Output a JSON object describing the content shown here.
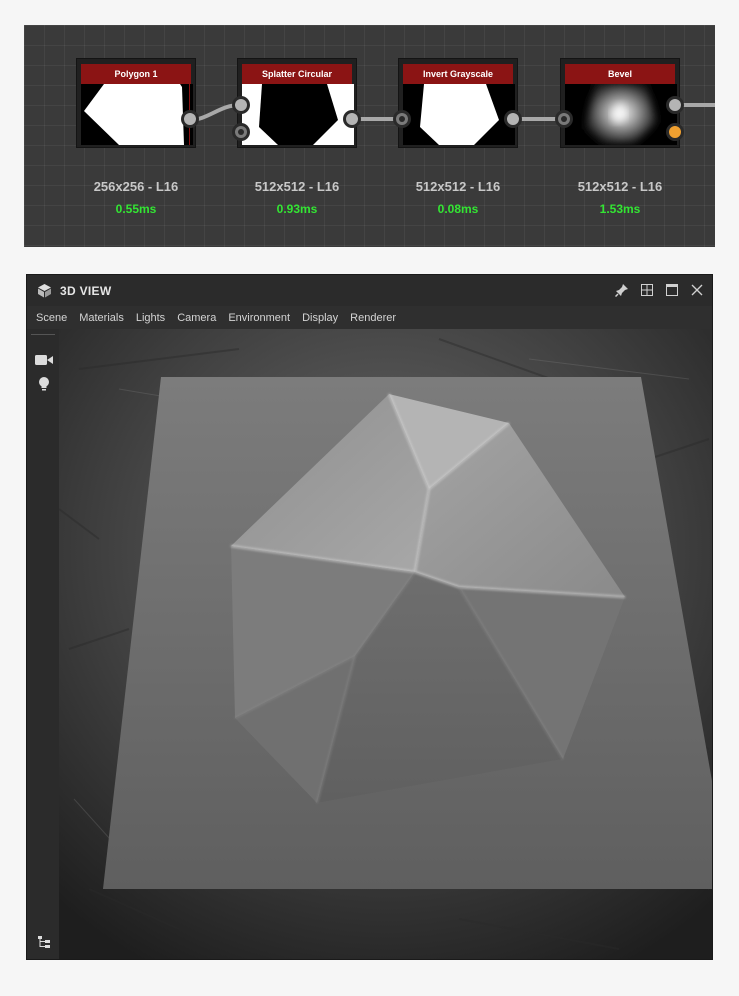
{
  "graph": {
    "nodes": [
      {
        "title": "Polygon 1",
        "resolution": "256x256 - L16",
        "time": "0.55ms"
      },
      {
        "title": "Splatter Circular",
        "resolution": "512x512 - L16",
        "time": "0.93ms"
      },
      {
        "title": "Invert Grayscale",
        "resolution": "512x512 - L16",
        "time": "0.08ms"
      },
      {
        "title": "Bevel",
        "resolution": "512x512 - L16",
        "time": "1.53ms"
      }
    ]
  },
  "view3d": {
    "title": "3D VIEW",
    "menu": [
      "Scene",
      "Materials",
      "Lights",
      "Camera",
      "Environment",
      "Display",
      "Renderer"
    ],
    "icons": {
      "title": "cube-icon",
      "pin": "pin-icon",
      "layout": "split-layout-icon",
      "maximize": "maximize-icon",
      "close": "close-icon",
      "camera": "video-camera-icon",
      "light": "light-bulb-icon",
      "tree": "scene-tree-icon"
    }
  },
  "colors": {
    "node_header": "#8b1414",
    "time_text": "#33e633",
    "output_port_orange": "#f0a030"
  }
}
